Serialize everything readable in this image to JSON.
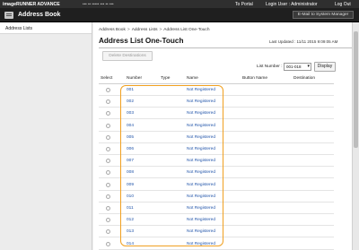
{
  "topbar": {
    "brand": "imageRUNNER ADVANCE",
    "host": "••• •• ••••• ••• •• •••",
    "to_portal": "To Portal",
    "login_user_label": "Login User : Administrator",
    "logout": "Log Out"
  },
  "titlebar": {
    "title": "Address Book",
    "mail_button": "E-Mail to System Manager"
  },
  "sidebar": {
    "items": [
      {
        "label": "Address Lists"
      }
    ]
  },
  "breadcrumb": {
    "items": [
      "Address Book",
      "Address Lists",
      "Address List One-Touch"
    ],
    "separator": ">"
  },
  "page": {
    "title": "Address List One-Touch",
    "last_updated": "Last Updated : 11/11 2015 9:09:05 AM",
    "delete_button": "Delete Destinations",
    "list_number_label": "List Number :",
    "list_number_value": "001-018",
    "display_button": "Display"
  },
  "table": {
    "headers": {
      "select": "Select",
      "number": "Number",
      "type": "Type",
      "name": "Name",
      "button_name": "Button Name",
      "destination": "Destination"
    },
    "rows": [
      {
        "number": "001",
        "name": "Not Registered"
      },
      {
        "number": "002",
        "name": "Not Registered"
      },
      {
        "number": "003",
        "name": "Not Registered"
      },
      {
        "number": "004",
        "name": "Not Registered"
      },
      {
        "number": "005",
        "name": "Not Registered"
      },
      {
        "number": "006",
        "name": "Not Registered"
      },
      {
        "number": "007",
        "name": "Not Registered"
      },
      {
        "number": "008",
        "name": "Not Registered"
      },
      {
        "number": "009",
        "name": "Not Registered"
      },
      {
        "number": "010",
        "name": "Not Registered"
      },
      {
        "number": "011",
        "name": "Not Registered"
      },
      {
        "number": "012",
        "name": "Not Registered"
      },
      {
        "number": "013",
        "name": "Not Registered"
      },
      {
        "number": "014",
        "name": "Not Registered"
      }
    ]
  },
  "colors": {
    "link": "#2255aa",
    "highlight": "#f0a020",
    "titlebar": "#1f1f1f"
  },
  "icons": {
    "refresh": "refresh-icon",
    "app": "address-book-icon"
  }
}
